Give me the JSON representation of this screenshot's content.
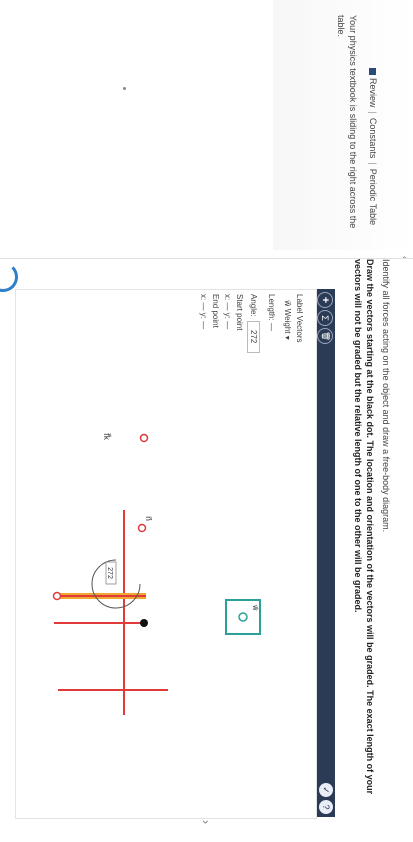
{
  "nav": {
    "review": "Review",
    "constants": "Constants",
    "periodic_table": "Periodic Table",
    "separator": "|"
  },
  "problem": {
    "text": "Your physics textbook is sliding to the right across the table."
  },
  "instructions": {
    "line1": "Identify all forces acting on the object and draw a free-body diagram.",
    "line2": "Draw the vectors starting at the black dot. The location and orientation of the vectors will be graded. The exact length of your vectors will not be graded but the relative length of one to the other will be graded."
  },
  "toolbar": {
    "add": "+",
    "sum": "Σ",
    "trash": "🗑",
    "check": "✓",
    "help": "?"
  },
  "vector_panel": {
    "label_vectors": "Label Vectors",
    "selected_vector": "w⃗  Weight ▾",
    "length_label": "Length:",
    "length_value": "—",
    "angle_label": "Angle:",
    "angle_value": "272",
    "start_point": "Start point",
    "start_xy": "x: —  y: —",
    "end_point": "End point",
    "end_xy": "x: —  y: —"
  },
  "diagram": {
    "normal_label": "n⃗",
    "friction_label": "f⃗k",
    "weight_label": "w⃗",
    "angle_badge": "272",
    "colors": {
      "vector": "#e03a3a",
      "selected": "#f0a830",
      "box": "#2aa198",
      "dot": "#111111"
    }
  }
}
